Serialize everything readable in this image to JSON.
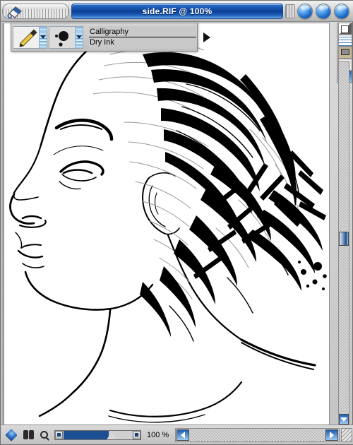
{
  "window": {
    "title": "side.RIF @ 100%",
    "buttons": [
      {
        "name": "minimize-button",
        "label": ""
      },
      {
        "name": "zoom-button",
        "label": ""
      },
      {
        "name": "close-button",
        "label": ""
      }
    ],
    "grip_icon": "paint-bucket-icon"
  },
  "brush_palette": {
    "tool_icon": "pen-nib-icon",
    "variant_preview_icon": "brush-dab-preview-icon",
    "category": "Calligraphy",
    "variant": "Dry Ink",
    "expand_arrow_icon": "triangle-right-icon",
    "tool_dropdown_icon": "chevron-down-icon",
    "variant_dropdown_icon": "chevron-down-icon"
  },
  "right_toolstrip": {
    "items": [
      {
        "name": "layers-icon",
        "label": ""
      },
      {
        "name": "grid-icon",
        "label": ""
      },
      {
        "name": "monitor-icon",
        "label": ""
      },
      {
        "name": "star-icon",
        "label": "✦"
      },
      {
        "name": "scroll-up-icon",
        "label": ""
      }
    ]
  },
  "statusbar": {
    "gem_icon": "gem-icon",
    "binoculars_icon": "binoculars-icon",
    "magnifier_icon": "magnifier-icon",
    "zoom_value": "100 %",
    "slider_left_icon": "slider-left-end",
    "slider_right_icon": "slider-right-end",
    "scroll_left_icon": "arrow-left-icon",
    "scroll_right_icon": "arrow-right-icon",
    "resize_grip_icon": "resize-grip-icon"
  },
  "canvas": {
    "document_name": "side.RIF",
    "zoom_level": "100%",
    "artwork_description": "Black ink line drawing of a woman's head in left profile with bold calligraphic brush strokes forming the hair",
    "ink_color": "#000000",
    "paper_color": "#ffffff"
  }
}
